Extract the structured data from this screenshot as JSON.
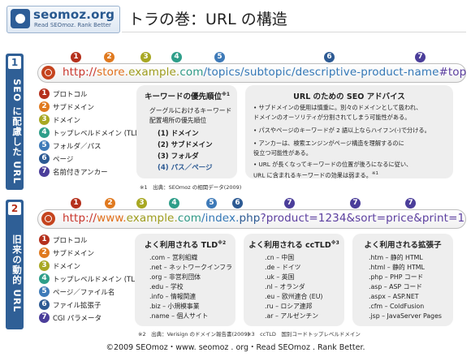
{
  "header": {
    "logo_name": "seomoz.org",
    "logo_tagline": "Read SEOmoz. Rank Better",
    "title": "トラの巻：URL の構造"
  },
  "section1": {
    "number": "1",
    "side_label": "SEO に配慮した URL",
    "url_parts": [
      "http://",
      "store.",
      "example.",
      "com",
      "/topics/",
      "subtopic/",
      "descriptive-product-name",
      "#top"
    ],
    "markers": [
      "1",
      "2",
      "3",
      "4",
      "5",
      "6",
      "7"
    ],
    "legend": [
      {
        "n": "1",
        "label": "プロトコル"
      },
      {
        "n": "2",
        "label": "サブドメイン"
      },
      {
        "n": "3",
        "label": "ドメイン"
      },
      {
        "n": "4",
        "label": "トップレベルドメイン (TLD)"
      },
      {
        "n": "5",
        "label": "フォルダ／パス"
      },
      {
        "n": "6",
        "label": "ページ"
      },
      {
        "n": "7",
        "label": "名前付きアンカー"
      }
    ],
    "keyword_box": {
      "title": "キーワードの優先順位",
      "title_sup": "※1",
      "desc_line1": "グーグルにおけるキーワード",
      "desc_line2": "配置場所の優先順位",
      "items": [
        "(1) ドメイン",
        "(2) サブドメイン",
        "(3) フォルダ",
        "(4) パス／ページ"
      ]
    },
    "advice_box": {
      "title": "URL のための SEO アドバイス",
      "lines": [
        "• サブドメインの使用は慎重に。別々のドメインとして扱われ、",
        "  ドメインのオーソリティが分割されてしまう可能性がある。",
        "• パスやページのキーワードが 2 語以上ならハイフン(-)で分ける。",
        "• アンカーは、検索エンジンがページ構造を理解するのに",
        "  役立つ可能性がある。",
        "• URL が長くなってキーワードの位置が後ろになるに従い、",
        "  URL に含まれるキーワードの効果は弱まる。"
      ],
      "last_sup": "※1"
    },
    "footnote": "※1　出典：SEOmoz の相関データ(2009)"
  },
  "section2": {
    "number": "2",
    "side_label": "旧来の動的 URL",
    "url_parts": [
      "http://",
      "www.",
      "example.",
      "com",
      "/index.",
      "php",
      "?product=1234",
      "&sort=price",
      "&print=1"
    ],
    "markers": [
      "1",
      "2",
      "3",
      "4",
      "5",
      "6",
      "7",
      "7",
      "7"
    ],
    "legend": [
      {
        "n": "1",
        "label": "プロトコル"
      },
      {
        "n": "2",
        "label": "サブドメイン"
      },
      {
        "n": "3",
        "label": "ドメイン"
      },
      {
        "n": "4",
        "label": "トップレベルドメイン (TLD)"
      },
      {
        "n": "5",
        "label": "ページ／ファイル名"
      },
      {
        "n": "6",
        "label": "ファイル拡張子"
      },
      {
        "n": "7",
        "label": "CGI パラメータ"
      }
    ],
    "tld_box": {
      "title": "よく利用される TLD",
      "title_sup": "※2",
      "rows": [
        ".com  –  営利組織",
        ".net  –  ネットワークインフラ",
        ".org  –  非営利団体",
        ".edu  –  学校",
        ".info  –  情報関連",
        ".biz  –  小規模事業",
        ".name  –  個人サイト"
      ]
    },
    "cctld_box": {
      "title": "よく利用される ccTLD",
      "title_sup": "※3",
      "rows": [
        ".cn  –  中国",
        ".de  –  ドイツ",
        ".uk  –  英国",
        ".nl  –  オランダ",
        ".eu  –  欧州連合 (EU)",
        ".ru  –  ロシア連邦",
        ".ar  –  アルゼンチン"
      ]
    },
    "ext_box": {
      "title": "よく利用される拡張子",
      "rows": [
        ".htm  –  静的 HTML",
        ".html  –  静的 HTML",
        ".php  –  PHP コード",
        ".asp  –  ASP コード",
        ".aspx  –  ASP.NET",
        ".cfm  –  ColdFusion",
        ".jsp  –  JavaServer Pages"
      ]
    },
    "footnote2": "※2　出典：Verisign のドメイン報告書(2009)",
    "footnote3": "※3　ccTLD　国別コードトップレベルドメイン"
  },
  "footer": "©2009 SEOmoz・www. seomoz . org・Read SEOmoz . Rank Better."
}
